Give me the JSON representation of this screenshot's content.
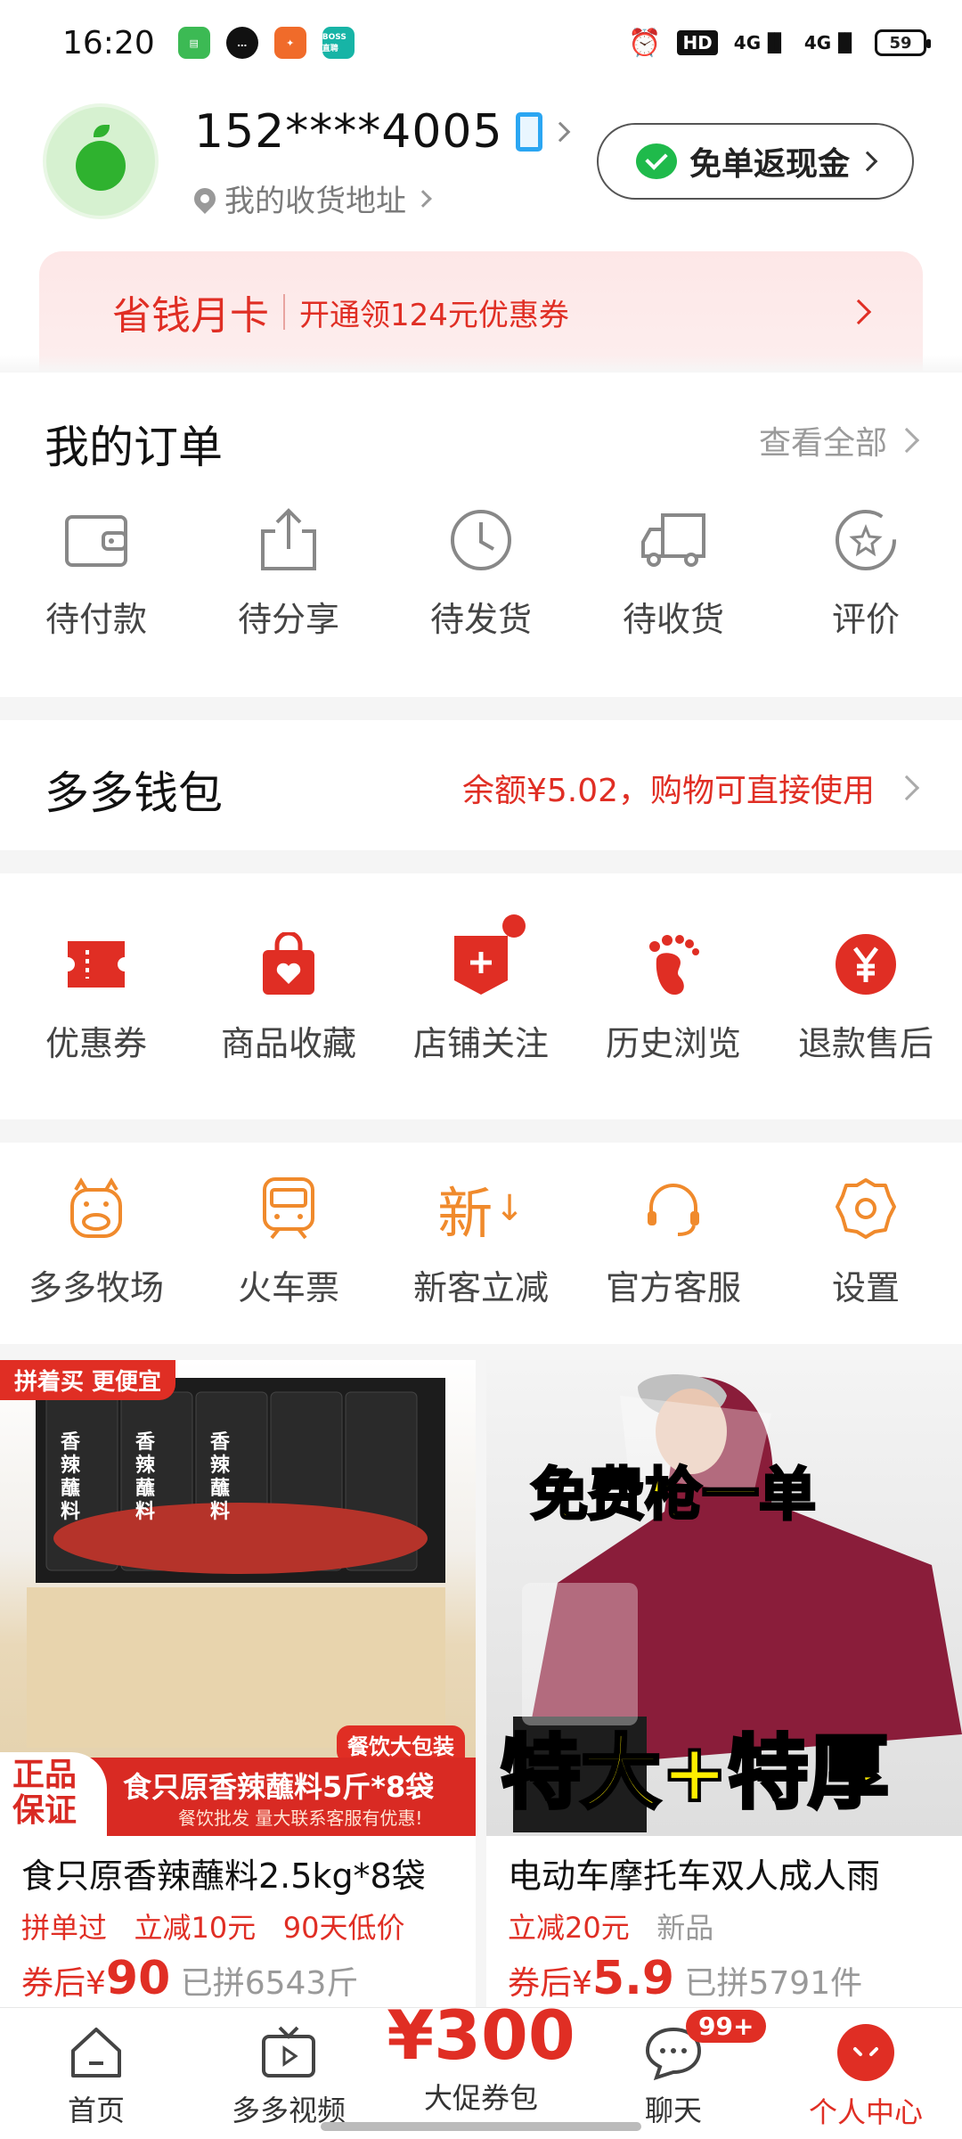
{
  "status_bar": {
    "time": "16:20",
    "app_boss_label": "BOSS直聘",
    "hd_label": "HD",
    "net_label_1": "4G",
    "net_label_2": "4G",
    "battery": "59"
  },
  "profile": {
    "phone": "152****4005",
    "address_label": "我的收货地址",
    "cashback_label": "免单返现金"
  },
  "month_card": {
    "title": "省钱月卡",
    "subtitle": "开通领124元优惠券"
  },
  "orders": {
    "title": "我的订单",
    "view_all": "查看全部",
    "items": [
      {
        "label": "待付款",
        "icon": "wallet-icon"
      },
      {
        "label": "待分享",
        "icon": "share-icon"
      },
      {
        "label": "待发货",
        "icon": "clock-icon"
      },
      {
        "label": "待收货",
        "icon": "truck-icon"
      },
      {
        "label": "评价",
        "icon": "star-icon"
      }
    ]
  },
  "wallet": {
    "title": "多多钱包",
    "balance_text": "余额¥5.02，购物可直接使用"
  },
  "services": {
    "items": [
      {
        "label": "优惠券",
        "icon": "coupon-icon"
      },
      {
        "label": "商品收藏",
        "icon": "bag-heart-icon"
      },
      {
        "label": "店铺关注",
        "icon": "store-plus-icon"
      },
      {
        "label": "历史浏览",
        "icon": "footprint-icon"
      },
      {
        "label": "退款售后",
        "icon": "yen-icon"
      }
    ]
  },
  "tools": {
    "items": [
      {
        "label": "多多牧场",
        "icon": "cow-icon"
      },
      {
        "label": "火车票",
        "icon": "train-icon"
      },
      {
        "label": "新客立减",
        "icon": "new-icon",
        "glyph": "新"
      },
      {
        "label": "官方客服",
        "icon": "headset-icon"
      },
      {
        "label": "设置",
        "icon": "gear-icon"
      }
    ]
  },
  "products": [
    {
      "corner_tag": "拼着买 更便宜",
      "pack_label": "香辣蘸料",
      "catering_tag": "餐饮大包装",
      "guarantee": "正品保证",
      "banner_text": "食只原香辣蘸料5斤*8袋",
      "banner_sub": "餐饮批发 量大联系客服有优惠!",
      "name": "食只原香辣蘸料2.5kg*8袋",
      "tags": [
        "拼单过",
        "立减10元",
        "90天低价"
      ],
      "price_prefix": "券后¥",
      "price": "90",
      "sold": "已拼6543斤"
    },
    {
      "overlay_top": "免费枪一单",
      "overlay_bottom": "特大+特厚",
      "name": "电动车摩托车双人成人雨",
      "tags": [
        "立减20元"
      ],
      "tag_gray": "新品",
      "price_prefix": "券后¥",
      "price": "5.9",
      "sold": "已拼5791件"
    }
  ],
  "bottom_nav": {
    "items": [
      {
        "label": "首页",
        "icon": "home-icon"
      },
      {
        "label": "多多视频",
        "icon": "video-icon"
      },
      {
        "label": "大促券包",
        "icon": "coupon-pack",
        "big": "¥300"
      },
      {
        "label": "聊天",
        "icon": "chat-icon",
        "badge": "99+"
      },
      {
        "label": "个人中心",
        "icon": "profile-icon"
      }
    ]
  },
  "colors": {
    "brand_red": "#e02e24",
    "tool_orange": "#f08a2c",
    "wechat_green": "#1fba4b"
  }
}
